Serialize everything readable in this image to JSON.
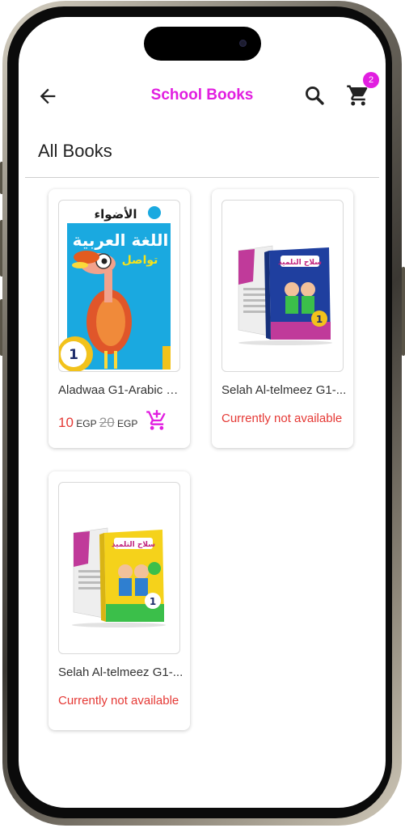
{
  "appbar": {
    "title": "School Books",
    "back_icon": "arrow-left-icon",
    "search_icon": "search-icon",
    "cart_icon": "shopping-cart-icon",
    "cart_count": "2"
  },
  "section": {
    "title": "All Books"
  },
  "products": [
    {
      "name": "Aladwaa G1-Arabic B...",
      "price": "10",
      "price_currency": "EGP",
      "old_price": "20",
      "old_currency": "EGP",
      "cover_publisher": "الأضواء",
      "cover_title": "اللغة العربية",
      "cover_subtitle": "تواصل",
      "cover_grade": "1"
    },
    {
      "name": "Selah Al-telmeez G1-...",
      "status": "Currently not available",
      "cover_title": "سلاح التلميذ",
      "cover_grade": "1"
    },
    {
      "name": "Selah Al-telmeez G1-...",
      "status": "Currently not available",
      "cover_title": "سلاح التلميذ",
      "cover_grade": "1"
    }
  ],
  "colors": {
    "accent": "#e11ee0",
    "unavailable": "#e53935",
    "price": "#e53935"
  }
}
